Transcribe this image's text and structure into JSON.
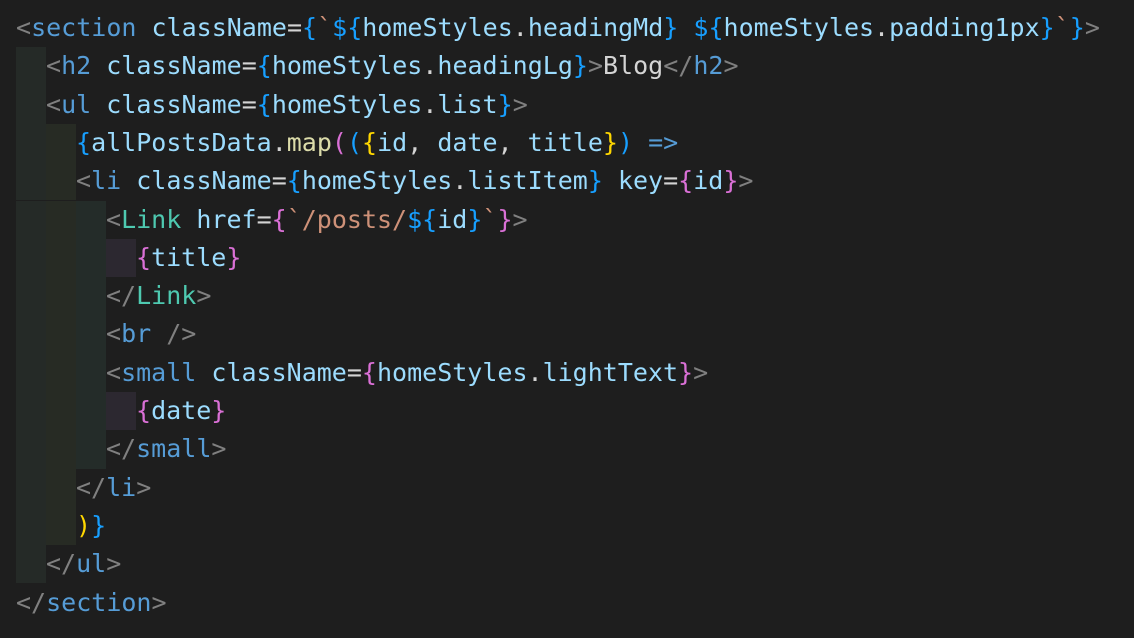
{
  "editor": {
    "language": "jsx",
    "lines": [
      {
        "indent": 0,
        "tokens": [
          {
            "t": "<",
            "c": "tok-bracket"
          },
          {
            "t": "section",
            "c": "tok-tag"
          },
          {
            "t": " ",
            "c": "tok-text"
          },
          {
            "t": "className",
            "c": "tok-attr"
          },
          {
            "t": "=",
            "c": "tok-punc"
          },
          {
            "t": "{",
            "c": "tok-brace2"
          },
          {
            "t": "`",
            "c": "tok-str"
          },
          {
            "t": "${",
            "c": "tok-brace2"
          },
          {
            "t": "homeStyles",
            "c": "tok-var"
          },
          {
            "t": ".",
            "c": "tok-punc"
          },
          {
            "t": "headingMd",
            "c": "tok-var"
          },
          {
            "t": "}",
            "c": "tok-brace2"
          },
          {
            "t": " ",
            "c": "tok-str"
          },
          {
            "t": "${",
            "c": "tok-brace2"
          },
          {
            "t": "homeStyles",
            "c": "tok-var"
          },
          {
            "t": ".",
            "c": "tok-punc"
          },
          {
            "t": "padding1px",
            "c": "tok-var"
          },
          {
            "t": "}",
            "c": "tok-brace2"
          },
          {
            "t": "`",
            "c": "tok-str"
          },
          {
            "t": "}",
            "c": "tok-brace2"
          },
          {
            "t": ">",
            "c": "tok-bracket"
          }
        ]
      },
      {
        "indent": 1,
        "tokens": [
          {
            "t": "<",
            "c": "tok-bracket"
          },
          {
            "t": "h2",
            "c": "tok-tag"
          },
          {
            "t": " ",
            "c": "tok-text"
          },
          {
            "t": "className",
            "c": "tok-attr"
          },
          {
            "t": "=",
            "c": "tok-punc"
          },
          {
            "t": "{",
            "c": "tok-brace2"
          },
          {
            "t": "homeStyles",
            "c": "tok-var"
          },
          {
            "t": ".",
            "c": "tok-punc"
          },
          {
            "t": "headingLg",
            "c": "tok-var"
          },
          {
            "t": "}",
            "c": "tok-brace2"
          },
          {
            "t": ">",
            "c": "tok-bracket"
          },
          {
            "t": "Blog",
            "c": "tok-text"
          },
          {
            "t": "</",
            "c": "tok-bracket"
          },
          {
            "t": "h2",
            "c": "tok-tag"
          },
          {
            "t": ">",
            "c": "tok-bracket"
          }
        ]
      },
      {
        "indent": 1,
        "tokens": [
          {
            "t": "<",
            "c": "tok-bracket"
          },
          {
            "t": "ul",
            "c": "tok-tag"
          },
          {
            "t": " ",
            "c": "tok-text"
          },
          {
            "t": "className",
            "c": "tok-attr"
          },
          {
            "t": "=",
            "c": "tok-punc"
          },
          {
            "t": "{",
            "c": "tok-brace2"
          },
          {
            "t": "homeStyles",
            "c": "tok-var"
          },
          {
            "t": ".",
            "c": "tok-punc"
          },
          {
            "t": "list",
            "c": "tok-var"
          },
          {
            "t": "}",
            "c": "tok-brace2"
          },
          {
            "t": ">",
            "c": "tok-bracket"
          }
        ]
      },
      {
        "indent": 2,
        "tokens": [
          {
            "t": "{",
            "c": "tok-brace2"
          },
          {
            "t": "allPostsData",
            "c": "tok-var"
          },
          {
            "t": ".",
            "c": "tok-punc"
          },
          {
            "t": "map",
            "c": "tok-fn"
          },
          {
            "t": "(",
            "c": "tok-brace"
          },
          {
            "t": "(",
            "c": "tok-brace2"
          },
          {
            "t": "{",
            "c": "tok-brace3"
          },
          {
            "t": "id",
            "c": "tok-var"
          },
          {
            "t": ", ",
            "c": "tok-punc"
          },
          {
            "t": "date",
            "c": "tok-var"
          },
          {
            "t": ", ",
            "c": "tok-punc"
          },
          {
            "t": "title",
            "c": "tok-var"
          },
          {
            "t": "}",
            "c": "tok-brace3"
          },
          {
            "t": ")",
            "c": "tok-brace2"
          },
          {
            "t": " ",
            "c": "tok-text"
          },
          {
            "t": "=>",
            "c": "tok-kw"
          }
        ]
      },
      {
        "indent": 2,
        "tokens": [
          {
            "t": "<",
            "c": "tok-bracket"
          },
          {
            "t": "li",
            "c": "tok-tag"
          },
          {
            "t": " ",
            "c": "tok-text"
          },
          {
            "t": "className",
            "c": "tok-attr"
          },
          {
            "t": "=",
            "c": "tok-punc"
          },
          {
            "t": "{",
            "c": "tok-brace2"
          },
          {
            "t": "homeStyles",
            "c": "tok-var"
          },
          {
            "t": ".",
            "c": "tok-punc"
          },
          {
            "t": "listItem",
            "c": "tok-var"
          },
          {
            "t": "}",
            "c": "tok-brace2"
          },
          {
            "t": " ",
            "c": "tok-text"
          },
          {
            "t": "key",
            "c": "tok-attr"
          },
          {
            "t": "=",
            "c": "tok-punc"
          },
          {
            "t": "{",
            "c": "tok-brace"
          },
          {
            "t": "id",
            "c": "tok-var"
          },
          {
            "t": "}",
            "c": "tok-brace"
          },
          {
            "t": ">",
            "c": "tok-bracket"
          }
        ]
      },
      {
        "indent": 3,
        "tokens": [
          {
            "t": "<",
            "c": "tok-bracket"
          },
          {
            "t": "Link",
            "c": "tok-comp"
          },
          {
            "t": " ",
            "c": "tok-text"
          },
          {
            "t": "href",
            "c": "tok-attr"
          },
          {
            "t": "=",
            "c": "tok-punc"
          },
          {
            "t": "{",
            "c": "tok-brace"
          },
          {
            "t": "`/posts/",
            "c": "tok-str"
          },
          {
            "t": "${",
            "c": "tok-brace2"
          },
          {
            "t": "id",
            "c": "tok-var"
          },
          {
            "t": "}",
            "c": "tok-brace2"
          },
          {
            "t": "`",
            "c": "tok-str"
          },
          {
            "t": "}",
            "c": "tok-brace"
          },
          {
            "t": ">",
            "c": "tok-bracket"
          }
        ]
      },
      {
        "indent": 4,
        "tokens": [
          {
            "t": "{",
            "c": "tok-brace"
          },
          {
            "t": "title",
            "c": "tok-var"
          },
          {
            "t": "}",
            "c": "tok-brace"
          }
        ]
      },
      {
        "indent": 3,
        "tokens": [
          {
            "t": "</",
            "c": "tok-bracket"
          },
          {
            "t": "Link",
            "c": "tok-comp"
          },
          {
            "t": ">",
            "c": "tok-bracket"
          }
        ]
      },
      {
        "indent": 3,
        "tokens": [
          {
            "t": "<",
            "c": "tok-bracket"
          },
          {
            "t": "br",
            "c": "tok-tag"
          },
          {
            "t": " ",
            "c": "tok-text"
          },
          {
            "t": "/>",
            "c": "tok-bracket"
          }
        ]
      },
      {
        "indent": 3,
        "tokens": [
          {
            "t": "<",
            "c": "tok-bracket"
          },
          {
            "t": "small",
            "c": "tok-tag"
          },
          {
            "t": " ",
            "c": "tok-text"
          },
          {
            "t": "className",
            "c": "tok-attr"
          },
          {
            "t": "=",
            "c": "tok-punc"
          },
          {
            "t": "{",
            "c": "tok-brace"
          },
          {
            "t": "homeStyles",
            "c": "tok-var"
          },
          {
            "t": ".",
            "c": "tok-punc"
          },
          {
            "t": "lightText",
            "c": "tok-var"
          },
          {
            "t": "}",
            "c": "tok-brace"
          },
          {
            "t": ">",
            "c": "tok-bracket"
          }
        ]
      },
      {
        "indent": 4,
        "tokens": [
          {
            "t": "{",
            "c": "tok-brace"
          },
          {
            "t": "date",
            "c": "tok-var"
          },
          {
            "t": "}",
            "c": "tok-brace"
          }
        ]
      },
      {
        "indent": 3,
        "tokens": [
          {
            "t": "</",
            "c": "tok-bracket"
          },
          {
            "t": "small",
            "c": "tok-tag"
          },
          {
            "t": ">",
            "c": "tok-bracket"
          }
        ]
      },
      {
        "indent": 2,
        "tokens": [
          {
            "t": "</",
            "c": "tok-bracket"
          },
          {
            "t": "li",
            "c": "tok-tag"
          },
          {
            "t": ">",
            "c": "tok-bracket"
          }
        ]
      },
      {
        "indent": 2,
        "tokens": [
          {
            "t": ")",
            "c": "tok-brace3"
          },
          {
            "t": "}",
            "c": "tok-brace2"
          }
        ]
      },
      {
        "indent": 1,
        "tokens": [
          {
            "t": "</",
            "c": "tok-bracket"
          },
          {
            "t": "ul",
            "c": "tok-tag"
          },
          {
            "t": ">",
            "c": "tok-bracket"
          }
        ]
      },
      {
        "indent": 0,
        "tokens": [
          {
            "t": "</",
            "c": "tok-bracket"
          },
          {
            "t": "section",
            "c": "tok-tag"
          },
          {
            "t": ">",
            "c": "tok-bracket"
          }
        ]
      }
    ]
  }
}
